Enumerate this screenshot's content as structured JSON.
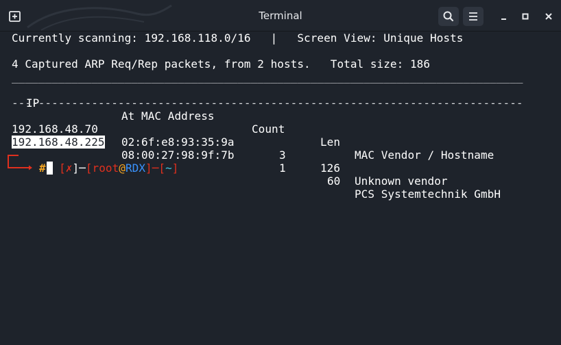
{
  "window": {
    "title": "Terminal",
    "icons": {
      "new_tab": "new-tab-icon",
      "search": "search-icon",
      "menu": "hamburger-menu-icon",
      "minimize": "minimize-icon",
      "maximize": "maximize-icon",
      "close": "close-icon"
    }
  },
  "terminal": {
    "status_line": "Currently scanning: 192.168.118.0/16   |   Screen View: Unique Hosts",
    "summary_line": "4 Captured ARP Req/Rep packets, from 2 hosts.   Total size: 186",
    "underscore_rule": "_____________________________________________________________________________",
    "header": {
      "ip": "IP",
      "mac": "At MAC Address",
      "count": "Count",
      "len": "Len",
      "vendor": "MAC Vendor / Hostname"
    },
    "dash_rule": "-----------------------------------------------------------------------------",
    "rows": [
      {
        "ip": "192.168.48.70",
        "mac": "02:6f:e8:93:35:9a",
        "count": "3",
        "len": "126",
        "vendor": "Unknown vendor"
      },
      {
        "ip": "192.168.48.225",
        "mac": "08:00:27:98:9f:7b",
        "count": "1",
        "len": "60",
        "vendor": "PCS Systemtechnik GmbH"
      }
    ],
    "prompt": {
      "open1": "[",
      "status": "✗",
      "close1": "]",
      "sep": "─",
      "open2": "[",
      "user": "root",
      "at": "@",
      "host": "RDX",
      "close2": "]",
      "open3": "[",
      "dir": "~",
      "close3": "]",
      "symbol": "#"
    }
  },
  "colors": {
    "background": "#1e232b",
    "titlebar": "#20252d",
    "prompt_red": "#e0301e",
    "prompt_blue": "#3a93ff",
    "prompt_orange": "#f5a623",
    "prompt_cyan": "#3ec6e0"
  }
}
